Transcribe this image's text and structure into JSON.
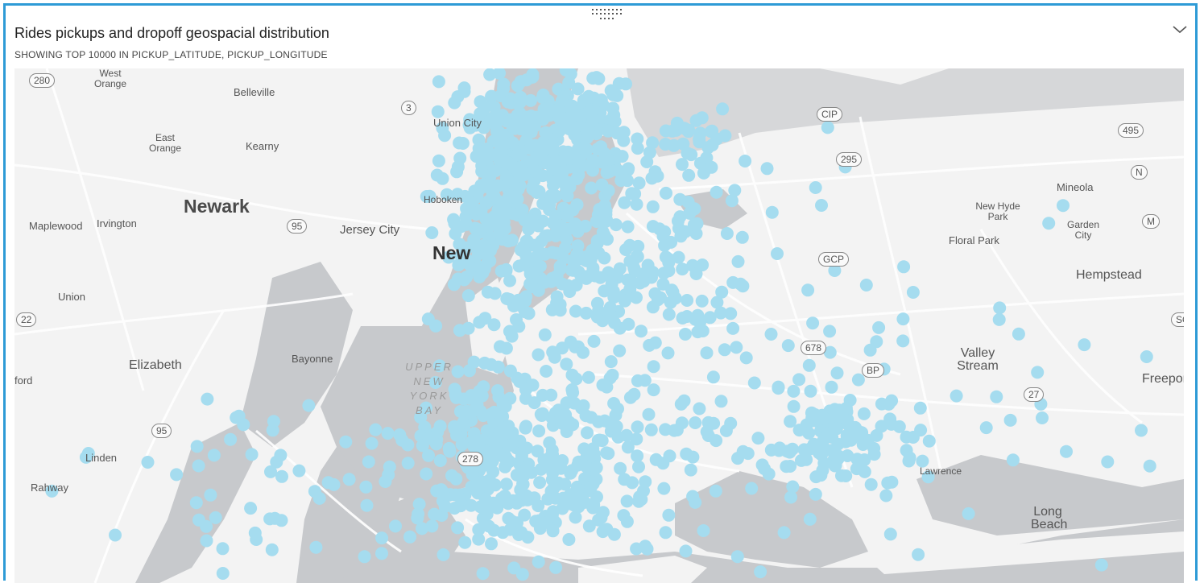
{
  "header": {
    "title": "Rides pickups and dropoff geospacial distribution",
    "subtitle": "SHOWING TOP 10000 IN PICKUP_LATITUDE, PICKUP_LONGITUDE"
  },
  "colors": {
    "border": "#2e9bd6",
    "point": "#a5dcef",
    "water": "#c7c9cc",
    "land": "#f3f3f3"
  },
  "map": {
    "cities": {
      "newark": "Newark",
      "jersey_city": "Jersey City",
      "new_york": "New",
      "elizabeth": "Elizabeth",
      "hempstead": "Hempstead",
      "valley_stream": "Valley Stream",
      "long_beach": "Long Beach",
      "freeport": "Freepor",
      "belleville": "Belleville",
      "kearny": "Kearny",
      "east_orange": "East Orange",
      "west_orange": "West Orange",
      "maplewood": "Maplewood",
      "irvington": "Irvington",
      "union": "Union",
      "bayonne": "Bayonne",
      "linden": "Linden",
      "rahway": "Rahway",
      "ford": "ford",
      "union_city": "Union City",
      "hoboken": "Hoboken",
      "mineola": "Mineola",
      "new_hyde_park": "New Hyde Park",
      "garden_city": "Garden City",
      "floral_park": "Floral Park",
      "lawrence": "Lawrence"
    },
    "water_label": [
      "UPPER",
      "NEW",
      "YORK",
      "BAY"
    ],
    "shields": [
      "280",
      "3",
      "95",
      "22",
      "95",
      "CIP",
      "295",
      "495",
      "N",
      "M",
      "GCP",
      "678",
      "BP",
      "27",
      "278",
      "SO"
    ]
  }
}
